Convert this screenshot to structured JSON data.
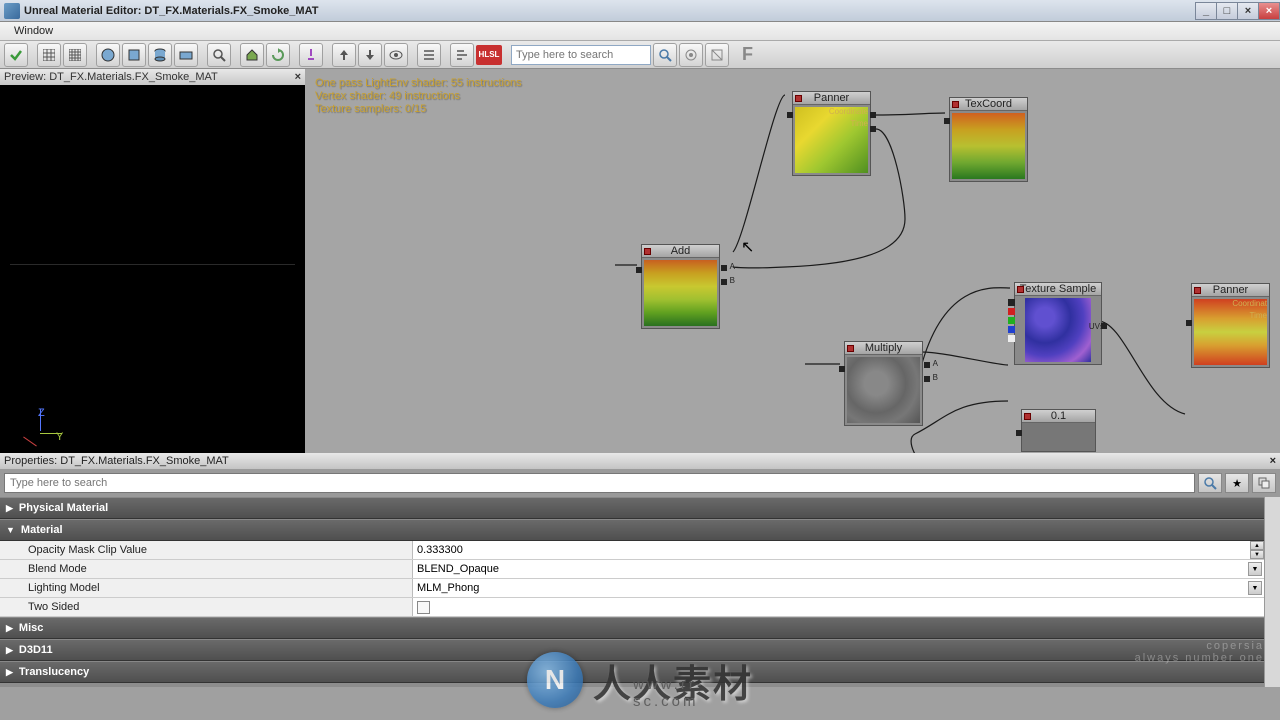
{
  "title": "Unreal Material Editor: DT_FX.Materials.FX_Smoke_MAT",
  "menu": {
    "window": "Window"
  },
  "toolbar": {
    "search_placeholder": "Type here to search",
    "f_label": "F"
  },
  "preview": {
    "tab_label": "Preview: DT_FX.Materials.FX_Smoke_MAT",
    "axis_z": "Z",
    "axis_y": "Y"
  },
  "shader_stats": {
    "line1": "One pass LightEnv shader: 55 instructions",
    "line2": "Vertex shader: 49 instructions",
    "line3": "Texture samplers: 0/15"
  },
  "nodes": {
    "panner1": {
      "title": "Panner",
      "in_coord": "Coordinate",
      "in_time": "Time"
    },
    "texcoord": {
      "title": "TexCoord"
    },
    "add": {
      "title": "Add",
      "in_a": "A",
      "in_b": "B"
    },
    "texsample": {
      "title": "Texture Sample",
      "in_uvs": "UVs"
    },
    "multiply": {
      "title": "Multiply",
      "in_a": "A",
      "in_b": "B"
    },
    "panner2": {
      "title": "Panner",
      "in_coord": "Coordinat",
      "in_time": "Time"
    },
    "const": {
      "title": "0.1"
    }
  },
  "properties": {
    "title": "Properties: DT_FX.Materials.FX_Smoke_MAT",
    "search_placeholder": "Type here to search",
    "categories": {
      "physical": "Physical Material",
      "material": "Material",
      "misc": "Misc",
      "d3d11": "D3D11",
      "translucency": "Translucency"
    },
    "material_props": {
      "opacity_mask_label": "Opacity Mask Clip Value",
      "opacity_mask_value": "0.333300",
      "blend_mode_label": "Blend Mode",
      "blend_mode_value": "BLEND_Opaque",
      "lighting_model_label": "Lighting Model",
      "lighting_model_value": "MLM_Phong",
      "two_sided_label": "Two Sided"
    }
  },
  "watermark": {
    "main": "人人素材",
    "url": "www.rr-sc.com",
    "side1": "copersia",
    "side2": "always number one"
  }
}
